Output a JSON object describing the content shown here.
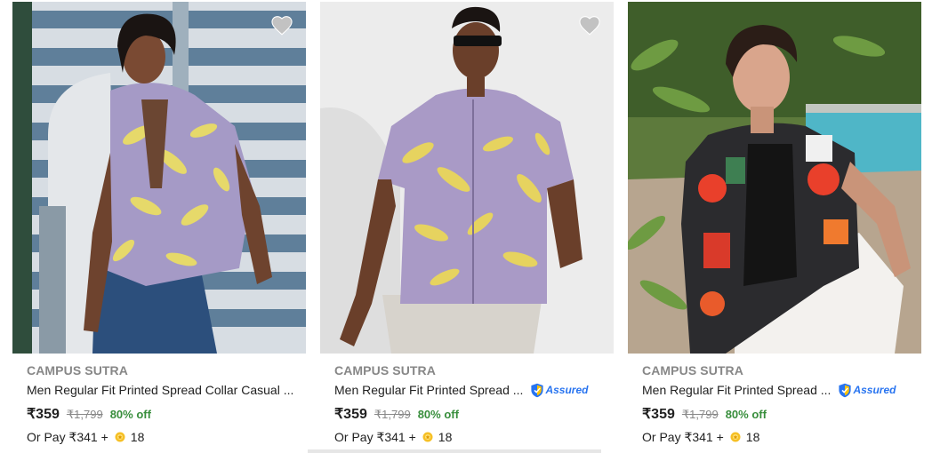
{
  "products": [
    {
      "brand": "CAMPUS SUTRA",
      "title": "Men Regular Fit Printed Spread Collar Casual ...",
      "assured": false,
      "price": "₹359",
      "mrp": "₹1,799",
      "discount": "80% off",
      "pay_prefix": "Or Pay ₹341 +",
      "coins": "18",
      "image_icon": "model-purple-floral-shirt-photo"
    },
    {
      "brand": "CAMPUS SUTRA",
      "title": "Men Regular Fit Printed Spread ...",
      "assured": true,
      "assured_label": "Assured",
      "price": "₹359",
      "mrp": "₹1,799",
      "discount": "80% off",
      "pay_prefix": "Or Pay ₹341 +",
      "coins": "18",
      "image_icon": "model-purple-floral-shirt-photo"
    },
    {
      "brand": "CAMPUS SUTRA",
      "title": "Men Regular Fit Printed Spread ...",
      "assured": true,
      "assured_label": "Assured",
      "price": "₹359",
      "mrp": "₹1,799",
      "discount": "80% off",
      "pay_prefix": "Or Pay ₹341 +",
      "coins": "18",
      "image_icon": "model-abstract-print-shirt-photo"
    }
  ],
  "colors": {
    "brand_gray": "#878787",
    "discount_green": "#388e3c",
    "assured_blue": "#2874f0",
    "coin_gold": "#f6c026",
    "wishlist_gray": "#c2c2c2"
  }
}
